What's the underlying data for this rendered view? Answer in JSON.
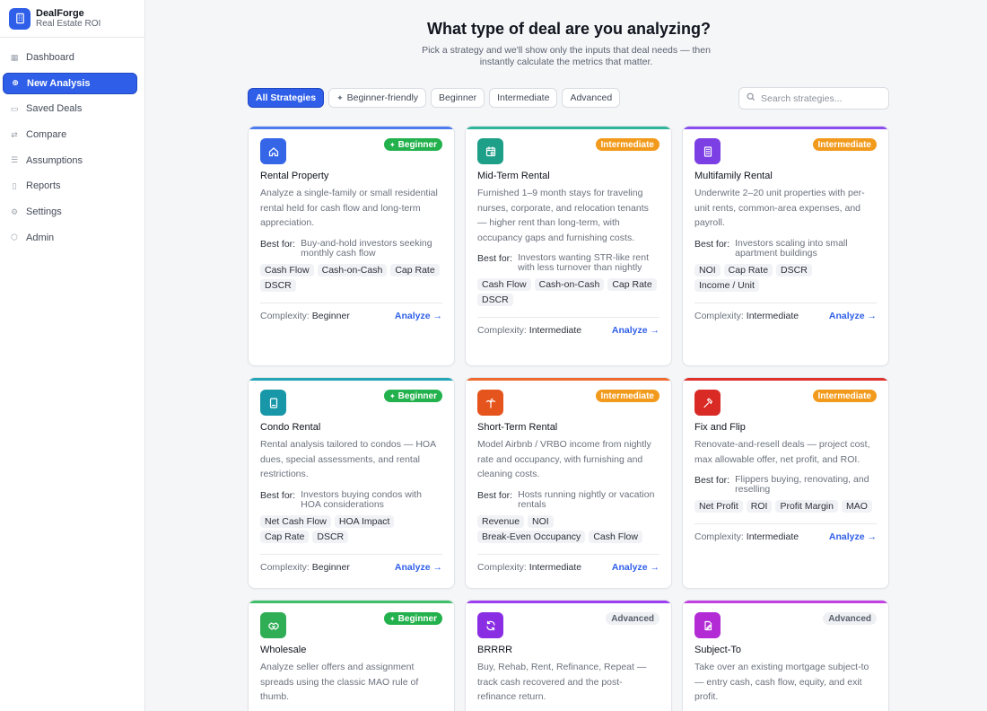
{
  "brand": {
    "name": "DealForge",
    "subtitle": "Real Estate ROI"
  },
  "nav": [
    {
      "label": "Dashboard",
      "icon": "dashboard-icon",
      "glyph": "▦",
      "active": false
    },
    {
      "label": "New Analysis",
      "icon": "plus-circle-icon",
      "glyph": "⊕",
      "active": true
    },
    {
      "label": "Saved Deals",
      "icon": "folder-icon",
      "glyph": "▭",
      "active": false
    },
    {
      "label": "Compare",
      "icon": "compare-icon",
      "glyph": "⇄",
      "active": false
    },
    {
      "label": "Assumptions",
      "icon": "sliders-icon",
      "glyph": "☰",
      "active": false
    },
    {
      "label": "Reports",
      "icon": "file-icon",
      "glyph": "▯",
      "active": false
    },
    {
      "label": "Settings",
      "icon": "gear-icon",
      "glyph": "⚙",
      "active": false
    },
    {
      "label": "Admin",
      "icon": "shield-icon",
      "glyph": "⬡",
      "active": false
    }
  ],
  "page": {
    "title": "What type of deal are you analyzing?",
    "subtitle": "Pick a strategy and we'll show only the inputs that deal needs — then instantly calculate the metrics that matter."
  },
  "filters": [
    {
      "label": "All Strategies",
      "active": true,
      "spark": false
    },
    {
      "label": "Beginner-friendly",
      "active": false,
      "spark": true
    },
    {
      "label": "Beginner",
      "active": false,
      "spark": false
    },
    {
      "label": "Intermediate",
      "active": false,
      "spark": false
    },
    {
      "label": "Advanced",
      "active": false,
      "spark": false
    }
  ],
  "search": {
    "placeholder": "Search strategies..."
  },
  "labels": {
    "best_for": "Best for:",
    "complexity": "Complexity:",
    "analyze": "Analyze →"
  },
  "cards": [
    {
      "title": "Rental Property",
      "badge": "Beginner",
      "badge_type": "beginner",
      "accent": "#4c7cf0",
      "icon_bg": "#3566e8",
      "icon": "home-icon",
      "desc": "Analyze a single-family or small residential rental held for cash flow and long-term appreciation.",
      "best_for": "Buy-and-hold investors seeking monthly cash flow",
      "tags": [
        "Cash Flow",
        "Cash-on-Cash",
        "Cap Rate",
        "DSCR"
      ],
      "complexity": "Beginner"
    },
    {
      "title": "Mid-Term Rental",
      "badge": "Intermediate",
      "badge_type": "intermediate",
      "accent": "#2fb59a",
      "icon_bg": "#1e9f88",
      "icon": "calendar-icon",
      "desc": "Furnished 1–9 month stays for traveling nurses, corporate, and relocation tenants — higher rent than long-term, with occupancy gaps and furnishing costs.",
      "best_for": "Investors wanting STR-like rent with less turnover than nightly",
      "tags": [
        "Cash Flow",
        "Cash-on-Cash",
        "Cap Rate",
        "DSCR"
      ],
      "complexity": "Intermediate"
    },
    {
      "title": "Multifamily Rental",
      "badge": "Intermediate",
      "badge_type": "intermediate",
      "accent": "#8b4cf0",
      "icon_bg": "#7b3fe4",
      "icon": "building-icon",
      "desc": "Underwrite 2–20 unit properties with per-unit rents, common-area expenses, and payroll.",
      "best_for": "Investors scaling into small apartment buildings",
      "tags": [
        "NOI",
        "Cap Rate",
        "DSCR",
        "Income / Unit"
      ],
      "complexity": "Intermediate"
    },
    {
      "title": "Condo Rental",
      "badge": "Beginner",
      "badge_type": "beginner",
      "accent": "#22a6b8",
      "icon_bg": "#1797a8",
      "icon": "condo-icon",
      "desc": "Rental analysis tailored to condos — HOA dues, special assessments, and rental restrictions.",
      "best_for": "Investors buying condos with HOA considerations",
      "tags": [
        "Net Cash Flow",
        "HOA Impact",
        "Cap Rate",
        "DSCR"
      ],
      "complexity": "Beginner"
    },
    {
      "title": "Short-Term Rental",
      "badge": "Intermediate",
      "badge_type": "intermediate",
      "accent": "#ef6a2e",
      "icon_bg": "#e4541c",
      "icon": "palm-tree-icon",
      "desc": "Model Airbnb / VRBO income from nightly rate and occupancy, with furnishing and cleaning costs.",
      "best_for": "Hosts running nightly or vacation rentals",
      "tags": [
        "Revenue",
        "NOI",
        "Break-Even Occupancy",
        "Cash Flow"
      ],
      "complexity": "Intermediate"
    },
    {
      "title": "Fix and Flip",
      "badge": "Intermediate",
      "badge_type": "intermediate",
      "accent": "#e0322c",
      "icon_bg": "#d92a25",
      "icon": "hammer-icon",
      "desc": "Renovate-and-resell deals — project cost, max allowable offer, net profit, and ROI.",
      "best_for": "Flippers buying, renovating, and reselling",
      "tags": [
        "Net Profit",
        "ROI",
        "Profit Margin",
        "MAO"
      ],
      "complexity": "Intermediate"
    },
    {
      "title": "Wholesale",
      "badge": "Beginner",
      "badge_type": "beginner",
      "accent": "#3fbf6a",
      "icon_bg": "#2fae55",
      "icon": "handshake-icon",
      "desc": "Analyze seller offers and assignment spreads using the classic MAO rule of thumb.",
      "best_for": "",
      "tags": [],
      "complexity": ""
    },
    {
      "title": "BRRRR",
      "badge": "Advanced",
      "badge_type": "advanced",
      "accent": "#9b3ff0",
      "icon_bg": "#8a2ee4",
      "icon": "refresh-icon",
      "desc": "Buy, Rehab, Rent, Refinance, Repeat — track cash recovered and the post-refinance return.",
      "best_for": "",
      "tags": [],
      "complexity": ""
    },
    {
      "title": "Subject-To",
      "badge": "Advanced",
      "badge_type": "advanced",
      "accent": "#c23fe0",
      "icon_bg": "#b22bd4",
      "icon": "document-edit-icon",
      "desc": "Take over an existing mortgage subject-to — entry cash, cash flow, equity, and exit profit.",
      "best_for": "",
      "tags": [],
      "complexity": ""
    }
  ]
}
